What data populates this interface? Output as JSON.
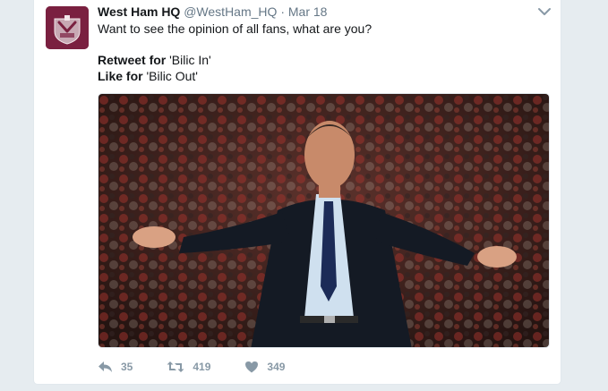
{
  "tweet": {
    "author_name": "West Ham HQ",
    "handle": "@WestHam_HQ",
    "separator": "·",
    "date": "Mar 18",
    "text_line1": "Want to see the opinion of all fans, what are you?",
    "retweet_prefix": "Retweet for",
    "retweet_option": " 'Bilic In'",
    "like_prefix": "Like for",
    "like_option": " 'Bilic Out'",
    "avatar_icon": "west-ham-crest-icon",
    "media_description_icon": "photo"
  },
  "actions": {
    "reply_count": "35",
    "retweet_count": "419",
    "like_count": "349"
  },
  "colors": {
    "avatar_bg": "#7a2040",
    "text": "#14171a",
    "muted": "#657786",
    "action": "#8899a6",
    "page_bg": "#e6ecf0"
  }
}
